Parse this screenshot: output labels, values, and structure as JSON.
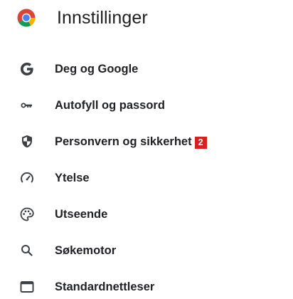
{
  "header": {
    "title": "Innstillinger",
    "logo_icon": "chrome-logo-icon"
  },
  "menu": {
    "items": [
      {
        "label": "Deg og Google",
        "icon": "google-g-icon"
      },
      {
        "label": "Autofyll og passord",
        "icon": "key-icon"
      },
      {
        "label": "Personvern og sikkerhet",
        "icon": "shield-icon",
        "badge": "2"
      },
      {
        "label": "Ytelse",
        "icon": "speedometer-icon"
      },
      {
        "label": "Utseende",
        "icon": "palette-icon"
      },
      {
        "label": "Søkemotor",
        "icon": "search-icon"
      },
      {
        "label": "Standardnettleser",
        "icon": "browser-window-icon"
      }
    ]
  },
  "colors": {
    "badge_background": "#d7211f",
    "icon_color": "#3c4043",
    "text_color": "#202124"
  }
}
